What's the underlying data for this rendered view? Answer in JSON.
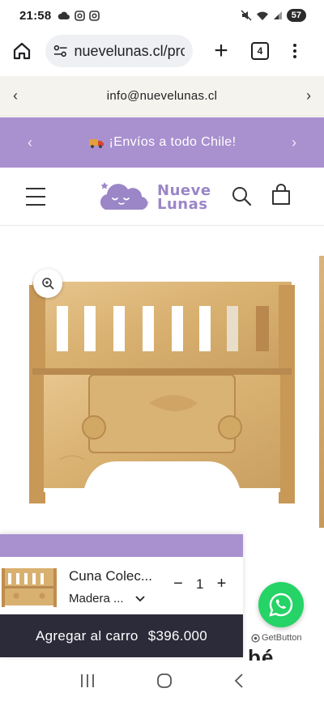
{
  "status_bar": {
    "time": "21:58",
    "battery": "57",
    "left_icons": [
      "cloud-icon",
      "instagram-icon",
      "instagram-icon"
    ],
    "right_icons": [
      "mute-icon",
      "wifi-icon",
      "signal-icon",
      "battery-icon"
    ]
  },
  "browser": {
    "url": "nuevelunas.cl/prc",
    "tab_count": "4"
  },
  "announcement": {
    "email": "info@nuevelunas.cl",
    "prev_icon": "chevron-left-icon",
    "next_icon": "chevron-right-icon"
  },
  "shipping_bar": {
    "text": "¡Envíos a todo Chile!",
    "icon": "truck-icon",
    "color": "#a990cf"
  },
  "header": {
    "logo_line1": "Nueve",
    "logo_line2": "Lunas",
    "brand_color": "#9b86c7"
  },
  "sticky_cart": {
    "product_name": "Cuna Colec...",
    "variant": "Madera ...",
    "quantity": "1",
    "minus_label": "−",
    "plus_label": "+",
    "button_label": "Agregar al carro",
    "price": "$396.000",
    "button_color": "#2b2b3a"
  },
  "whatsapp": {
    "credit": "GetButton",
    "color": "#25d366"
  },
  "product_title_peek": "bé"
}
